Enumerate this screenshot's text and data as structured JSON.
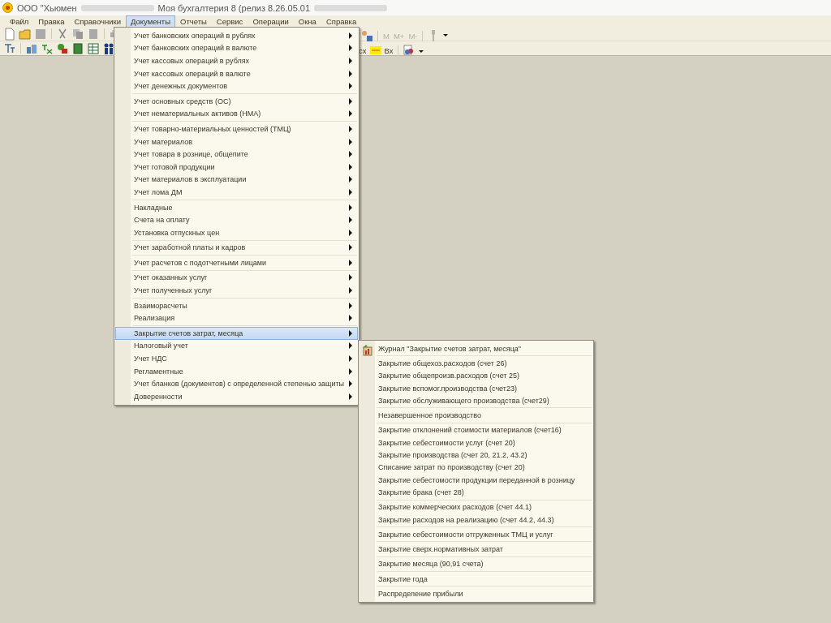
{
  "window": {
    "title_start": "ООО \"Хьюмен",
    "title_end": "Моя бухгалтерия 8 (релиз 8.26.05.01"
  },
  "menubar": [
    {
      "label": "Файл",
      "selected": false
    },
    {
      "label": "Правка",
      "selected": false
    },
    {
      "label": "Справочники",
      "selected": false
    },
    {
      "label": "Документы",
      "selected": true
    },
    {
      "label": "Отчеты",
      "selected": false
    },
    {
      "label": "Сервис",
      "selected": false
    },
    {
      "label": "Операции",
      "selected": false
    },
    {
      "label": "Окна",
      "selected": false
    },
    {
      "label": "Справка",
      "selected": false
    }
  ],
  "toolbar": {
    "row1_right": [
      {
        "label": "M",
        "disabled": true
      },
      {
        "label": "M+",
        "disabled": true
      },
      {
        "label": "M-",
        "disabled": true
      }
    ],
    "row2_right": [
      {
        "label": "сх",
        "disabled": false
      },
      {
        "label": "Вх",
        "disabled": false
      }
    ]
  },
  "documents_menu": {
    "groups": [
      {
        "items": [
          {
            "label": "Учет банковских операций в рублях",
            "selected": false,
            "submenu": true
          },
          {
            "label": "Учет банковских операций в валюте",
            "selected": false,
            "submenu": true
          },
          {
            "label": "Учет кассовых операций в рублях",
            "selected": false,
            "submenu": true
          },
          {
            "label": "Учет кассовых операций в валюте",
            "selected": false,
            "submenu": true
          },
          {
            "label": "Учет денежных документов",
            "selected": false,
            "submenu": true
          }
        ]
      },
      {
        "items": [
          {
            "label": "Учет основных средств (ОС)",
            "selected": false,
            "submenu": true
          },
          {
            "label": "Учет нематериальных активов (НМА)",
            "selected": false,
            "submenu": true
          }
        ]
      },
      {
        "items": [
          {
            "label": "Учет товарно-материальных ценностей (ТМЦ)",
            "selected": false,
            "submenu": true
          },
          {
            "label": "Учет материалов",
            "selected": false,
            "submenu": true
          },
          {
            "label": "Учет товара в рознице, общепите",
            "selected": false,
            "submenu": true
          },
          {
            "label": "Учет готовой продукции",
            "selected": false,
            "submenu": true
          },
          {
            "label": "Учет материалов в эксплуатации",
            "selected": false,
            "submenu": true
          },
          {
            "label": "Учет лома ДМ",
            "selected": false,
            "submenu": true
          }
        ]
      },
      {
        "items": [
          {
            "label": "Накладные",
            "selected": false,
            "submenu": true
          },
          {
            "label": "Счета на оплату",
            "selected": false,
            "submenu": true
          },
          {
            "label": "Установка отпускных цен",
            "selected": false,
            "submenu": true
          }
        ]
      },
      {
        "items": [
          {
            "label": "Учет заработной платы и кадров",
            "selected": false,
            "submenu": true
          }
        ]
      },
      {
        "items": [
          {
            "label": "Учет расчетов с подотчетными лицами",
            "selected": false,
            "submenu": true
          }
        ]
      },
      {
        "items": [
          {
            "label": "Учет оказанных услуг",
            "selected": false,
            "submenu": true
          },
          {
            "label": "Учет полученных услуг",
            "selected": false,
            "submenu": true
          }
        ]
      },
      {
        "items": [
          {
            "label": "Взаиморасчеты",
            "selected": false,
            "submenu": true
          },
          {
            "label": "Реализация",
            "selected": false,
            "submenu": true
          }
        ]
      },
      {
        "items": [
          {
            "label": "Закрытие счетов затрат, месяца",
            "selected": true,
            "submenu": true
          },
          {
            "label": "Налоговый учет",
            "selected": false,
            "submenu": true
          },
          {
            "label": "Учет НДС",
            "selected": false,
            "submenu": true
          },
          {
            "label": "Регламентные",
            "selected": false,
            "submenu": true
          },
          {
            "label": "Учет бланков (документов) с определенной степенью защиты",
            "selected": false,
            "submenu": true
          },
          {
            "label": "Доверенности",
            "selected": false,
            "submenu": true
          }
        ]
      }
    ]
  },
  "closing_submenu": {
    "groups": [
      {
        "items": [
          {
            "label": "Журнал \"Закрытие счетов затрат, месяца\"",
            "kind": "journal"
          }
        ]
      },
      {
        "items": [
          {
            "label": "Закрытие общехоз.расходов (счет 26)",
            "kind": "command"
          },
          {
            "label": "Закрытие общепроизв.расходов (счет 25)",
            "kind": "command"
          },
          {
            "label": "Закрытие вспомог.производства (счет23)",
            "kind": "command"
          },
          {
            "label": "Закрытие обслуживающего производства (счет29)",
            "kind": "command"
          }
        ]
      },
      {
        "items": [
          {
            "label": "Незавершенное производство",
            "kind": "command"
          }
        ]
      },
      {
        "items": [
          {
            "label": "Закрытие отклонений стоимости материалов (счет16)",
            "kind": "command"
          },
          {
            "label": "Закрытие себестоимости услуг (счет 20)",
            "kind": "command"
          },
          {
            "label": "Закрытие производства (счет 20, 21.2, 43.2)",
            "kind": "command"
          },
          {
            "label": "Списание затрат по производству (счет 20)",
            "kind": "command"
          },
          {
            "label": "Закрытие себестомости продукции переданной в розницу",
            "kind": "command"
          },
          {
            "label": "Закрытие брака (счет 28)",
            "kind": "command"
          }
        ]
      },
      {
        "items": [
          {
            "label": "Закрытие коммерческих расходов (счет 44.1)",
            "kind": "command"
          },
          {
            "label": "Закрытие расходов на реализацию (счет 44.2, 44.3)",
            "kind": "command"
          }
        ]
      },
      {
        "items": [
          {
            "label": "Закрытие себестоимости отгруженных ТМЦ и услуг",
            "kind": "command"
          }
        ]
      },
      {
        "items": [
          {
            "label": "Закрытие сверх.нормативных затрат",
            "kind": "command"
          }
        ]
      },
      {
        "items": [
          {
            "label": "Закрытие месяца (90,91 счета)",
            "kind": "command"
          }
        ]
      },
      {
        "items": [
          {
            "label": "Закрытие года",
            "kind": "command"
          }
        ]
      },
      {
        "items": [
          {
            "label": "Распределение прибыли",
            "kind": "command"
          }
        ]
      }
    ]
  }
}
